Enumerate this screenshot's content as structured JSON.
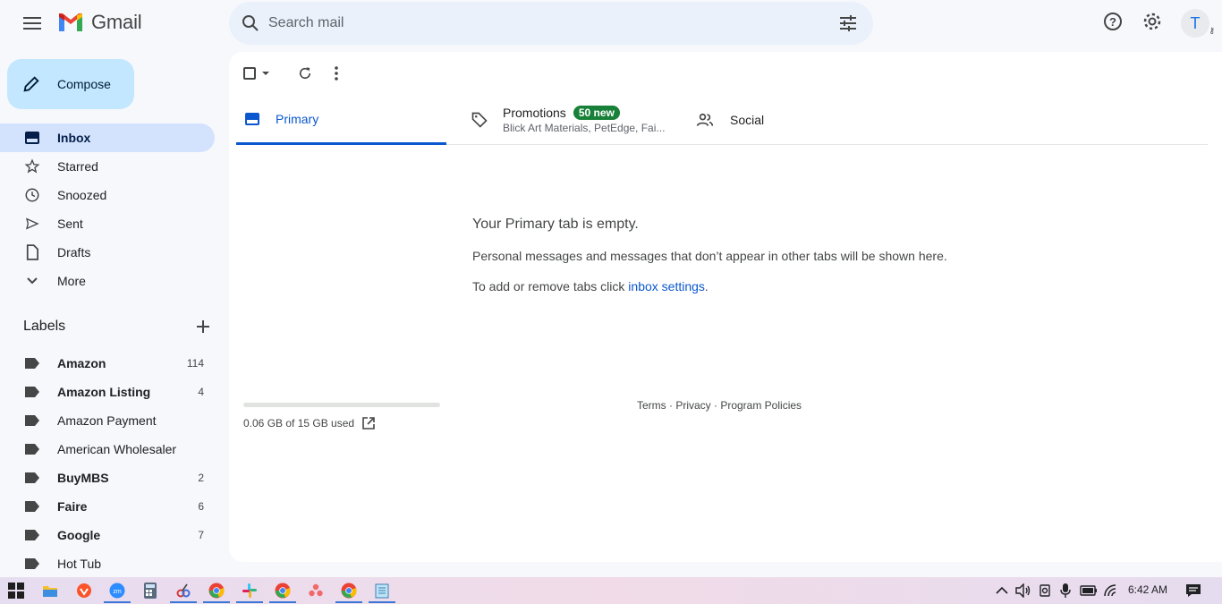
{
  "header": {
    "app_name": "Gmail",
    "search_placeholder": "Search mail",
    "avatar_initial": "T"
  },
  "sidebar": {
    "compose_label": "Compose",
    "nav": [
      {
        "label": "Inbox",
        "icon": "inbox-icon",
        "active": true
      },
      {
        "label": "Starred",
        "icon": "star-icon"
      },
      {
        "label": "Snoozed",
        "icon": "clock-icon"
      },
      {
        "label": "Sent",
        "icon": "send-icon"
      },
      {
        "label": "Drafts",
        "icon": "draft-icon"
      },
      {
        "label": "More",
        "icon": "chevron-down-icon"
      }
    ],
    "labels_title": "Labels",
    "labels": [
      {
        "name": "Amazon",
        "count": "114",
        "bold": true
      },
      {
        "name": "Amazon Listing",
        "count": "4",
        "bold": true
      },
      {
        "name": "Amazon Payment",
        "count": "",
        "bold": false
      },
      {
        "name": "American Wholesaler",
        "count": "",
        "bold": false
      },
      {
        "name": "BuyMBS",
        "count": "2",
        "bold": true
      },
      {
        "name": "Faire",
        "count": "6",
        "bold": true
      },
      {
        "name": "Google",
        "count": "7",
        "bold": true
      },
      {
        "name": "Hot Tub",
        "count": "",
        "bold": false
      }
    ]
  },
  "tabs": {
    "primary": "Primary",
    "promotions": "Promotions",
    "promotions_badge": "50 new",
    "promotions_senders": "Blick Art Materials, PetEdge, Fai...",
    "social": "Social"
  },
  "empty_state": {
    "title": "Your Primary tab is empty.",
    "description": "Personal messages and messages that don’t appear in other tabs will be shown here.",
    "tabs_prefix": "To add or remove tabs click ",
    "tabs_link": "inbox settings",
    "tabs_suffix": "."
  },
  "storage": {
    "used_text": "0.06 GB of 15 GB used",
    "used_fraction": 0.004
  },
  "footer": {
    "links": "Terms · Privacy · Program Policies"
  },
  "taskbar": {
    "time": "6:42 AM"
  }
}
